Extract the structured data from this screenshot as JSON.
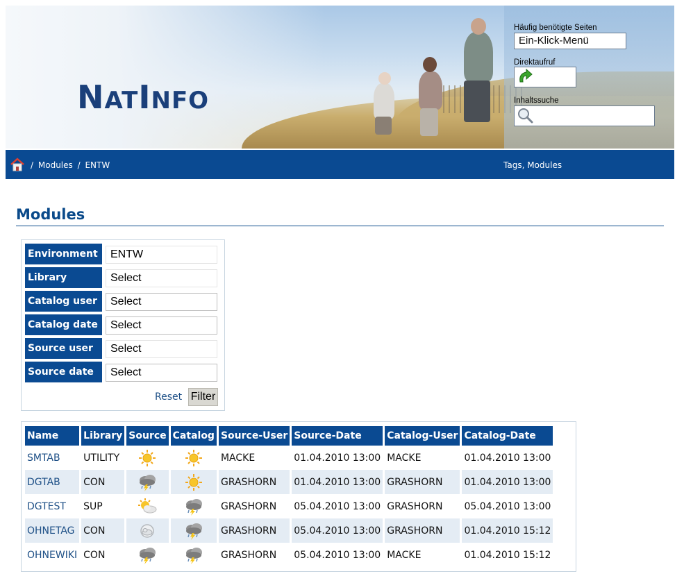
{
  "brand": {
    "logo_part1": "N",
    "logo_part2": "AT",
    "logo_part3": "I",
    "logo_part4": "NFO"
  },
  "sidebar_box": {
    "frequent_label": "Häufig benötigte Seiten",
    "frequent_value": "Ein-Klick-Menü",
    "direct_label": "Direktaufruf",
    "search_label": "Inhaltssuche"
  },
  "breadcrumb": {
    "sep1": "/",
    "item1": "Modules",
    "sep2": "/",
    "item2": "ENTW"
  },
  "nav_links": {
    "tags_modules": "Tags, Modules"
  },
  "page": {
    "title": "Modules"
  },
  "filter": {
    "rows": [
      {
        "label": "Environment",
        "value": "ENTW"
      },
      {
        "label": "Library",
        "value": "Select"
      },
      {
        "label": "Catalog user",
        "value": "Select"
      },
      {
        "label": "Catalog date",
        "value": "Select"
      },
      {
        "label": "Source user",
        "value": "Select"
      },
      {
        "label": "Source date",
        "value": "Select"
      }
    ],
    "reset_label": "Reset",
    "filter_label": "Filter"
  },
  "table": {
    "headers": [
      "Name",
      "Library",
      "Source",
      "Catalog",
      "Source-User",
      "Source-Date",
      "Catalog-User",
      "Catalog-Date"
    ],
    "rows": [
      {
        "name": "SMTAB",
        "library": "UTILITY",
        "source_icon": "sunny-icon",
        "catalog_icon": "sunny-icon",
        "source_user": "MACKE",
        "source_date": "01.04.2010 13:00",
        "catalog_user": "MACKE",
        "catalog_date": "01.04.2010 13:00"
      },
      {
        "name": "DGTAB",
        "library": "CON",
        "source_icon": "thunderstorm-icon",
        "catalog_icon": "sunny-icon",
        "source_user": "GRASHORN",
        "source_date": "01.04.2010 13:00",
        "catalog_user": "GRASHORN",
        "catalog_date": "01.04.2010 13:00"
      },
      {
        "name": "DGTEST",
        "library": "SUP",
        "source_icon": "partly-cloudy-icon",
        "catalog_icon": "thunderstorm-icon",
        "source_user": "GRASHORN",
        "source_date": "05.04.2010 13:00",
        "catalog_user": "GRASHORN",
        "catalog_date": "05.04.2010 13:00"
      },
      {
        "name": "OHNETAG",
        "library": "CON",
        "source_icon": "cloud-outline-icon",
        "catalog_icon": "thunderstorm-icon",
        "source_user": "GRASHORN",
        "source_date": "05.04.2010 13:00",
        "catalog_user": "GRASHORN",
        "catalog_date": "01.04.2010 15:12"
      },
      {
        "name": "OHNEWIKI",
        "library": "CON",
        "source_icon": "thunderstorm-icon",
        "catalog_icon": "thunderstorm-icon",
        "source_user": "GRASHORN",
        "source_date": "05.04.2010 13:00",
        "catalog_user": "MACKE",
        "catalog_date": "01.04.2010 15:12"
      }
    ]
  },
  "colors": {
    "brand_blue": "#0a4a92",
    "link_blue": "#1d4f86",
    "alt_row": "#e4ecf4"
  }
}
